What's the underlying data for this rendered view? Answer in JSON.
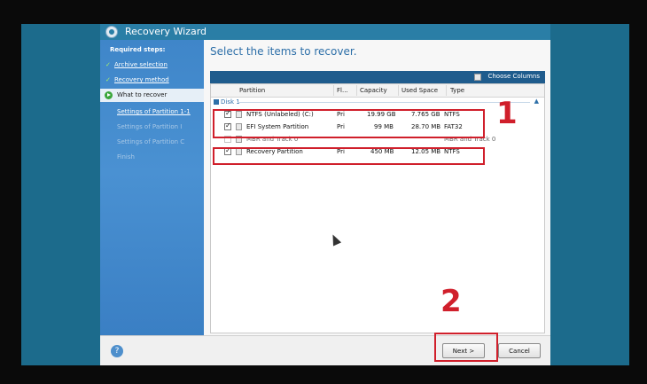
{
  "window": {
    "title": "Recovery Wizard"
  },
  "sidebar": {
    "heading": "Required steps:",
    "steps": [
      {
        "label": "Archive selection",
        "state": "done"
      },
      {
        "label": "Recovery method",
        "state": "done"
      },
      {
        "label": "What to recover",
        "state": "current"
      }
    ],
    "substeps": [
      {
        "label": "Settings of Partition 1-1",
        "state": "active"
      },
      {
        "label": "Settings of Partition I",
        "state": "disabled"
      },
      {
        "label": "Settings of Partition C",
        "state": "disabled"
      },
      {
        "label": "Finish",
        "state": "disabled"
      }
    ]
  },
  "main": {
    "heading": "Select the items to recover.",
    "toolbar": {
      "choose_columns": "Choose Columns"
    },
    "columns": [
      "Partition",
      "Fl...",
      "Capacity",
      "Used Space",
      "Type"
    ],
    "group": "Disk 1",
    "rows": [
      {
        "checked": true,
        "partition": "NTFS (Unlabeled) (C:)",
        "flags": "Pri",
        "capacity": "19.99 GB",
        "used": "7.765 GB",
        "type": "NTFS"
      },
      {
        "checked": true,
        "partition": "EFI System Partition",
        "flags": "Pri",
        "capacity": "99 MB",
        "used": "28.70 MB",
        "type": "FAT32"
      },
      {
        "checked": false,
        "partition": "MBR and Track 0",
        "flags": "",
        "capacity": "",
        "used": "",
        "type": "MBR and Track 0"
      },
      {
        "checked": true,
        "partition": "Recovery Partition",
        "flags": "Pri",
        "capacity": "450 MB",
        "used": "12.05 MB",
        "type": "NTFS"
      }
    ]
  },
  "annotations": {
    "step1": "1",
    "step2": "2"
  },
  "footer": {
    "help": "?",
    "next": "Next >",
    "cancel": "Cancel"
  },
  "colors": {
    "frame": "#1c6b8c",
    "sidebar": "#4a91d2",
    "annotation": "#d01f2b",
    "heading": "#2d6fa8"
  }
}
